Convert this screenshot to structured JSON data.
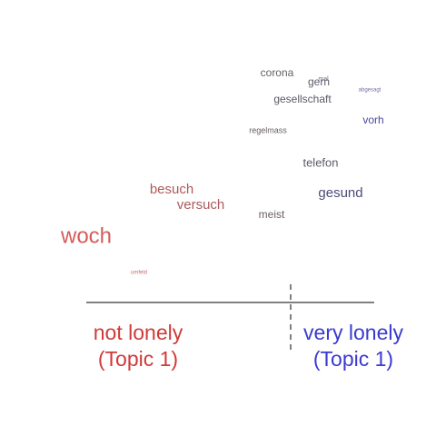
{
  "colors": {
    "left_pole": "#d03a3a",
    "right_pole": "#3a3ad0",
    "axis": "#000000"
  },
  "labels": {
    "left_line1": "not lonely",
    "left_line2": "(Topic 1)",
    "right_line1": "very lonely",
    "right_line2": "(Topic 1)"
  },
  "chart_data": {
    "type": "scatter",
    "description_axis": "horizontal position = loading from not lonely (left) to very lonely (right); vertical position and size = word importance",
    "xlim": [
      -1,
      1
    ],
    "ylim": [
      0,
      1
    ],
    "divider_x": 0.5,
    "points": [
      {
        "word": "woch",
        "x": -0.8,
        "y": 0.95,
        "size": 24,
        "color": "#d65a5a"
      },
      {
        "word": "umfeld",
        "x": -0.48,
        "y": 0.13,
        "size": 6,
        "color": "#c96b6b"
      },
      {
        "word": "besuch",
        "x": -0.18,
        "y": 0.55,
        "size": 15,
        "color": "#b05858"
      },
      {
        "word": "versuch",
        "x": -0.08,
        "y": 0.5,
        "size": 15,
        "color": "#ad5a5a"
      },
      {
        "word": "meist",
        "x": 0.19,
        "y": 0.46,
        "size": 12,
        "color": "#6b6060"
      },
      {
        "word": "corona",
        "x": 0.22,
        "y": 0.72,
        "size": 12,
        "color": "#666060"
      },
      {
        "word": "regelmass",
        "x": 0.18,
        "y": 0.42,
        "size": 9,
        "color": "#665e5e"
      },
      {
        "word": "gesellschaft",
        "x": 0.33,
        "y": 0.63,
        "size": 12,
        "color": "#5a5a66"
      },
      {
        "word": "telefon",
        "x": 0.41,
        "y": 0.6,
        "size": 13,
        "color": "#5c5c68"
      },
      {
        "word": "gern",
        "x": 0.44,
        "y": 0.67,
        "size": 12,
        "color": "#5c5c6a"
      },
      {
        "word": "mal",
        "x": 0.46,
        "y": 0.68,
        "size": 7,
        "color": "#6a6a80"
      },
      {
        "word": "gesund",
        "x": 0.62,
        "y": 0.48,
        "size": 15,
        "color": "#4c4c78"
      },
      {
        "word": "abgesagt",
        "x": 0.8,
        "y": 0.38,
        "size": 6,
        "color": "#6f6fa8"
      },
      {
        "word": "vorh",
        "x": 0.85,
        "y": 0.56,
        "size": 12,
        "color": "#4a4aa0"
      }
    ]
  }
}
